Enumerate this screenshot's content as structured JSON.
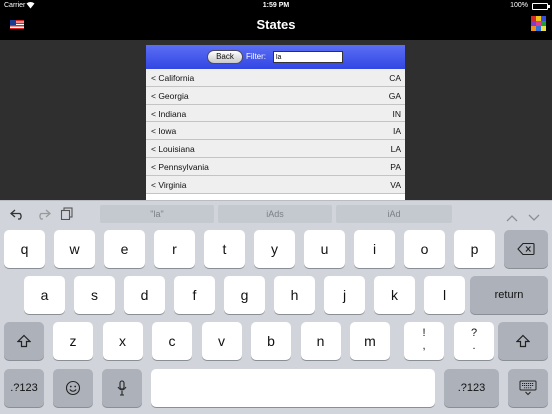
{
  "status_bar": {
    "carrier": "Carrier",
    "time": "1:59 PM",
    "battery": "100%"
  },
  "nav": {
    "title": "States",
    "grid_colors": [
      "#d62a2a",
      "#f2c318",
      "#3a4fd9",
      "#7f3cc8",
      "#e23c8e",
      "#1f9e3a",
      "#f28c1a",
      "#2f71d6",
      "#e8e34a"
    ]
  },
  "filter": {
    "back_label": "Back",
    "label": "Filter:",
    "value": "la"
  },
  "states": [
    {
      "name": "< California",
      "abbr": "CA"
    },
    {
      "name": "< Georgia",
      "abbr": "GA"
    },
    {
      "name": "< Indiana",
      "abbr": "IN"
    },
    {
      "name": "< Iowa",
      "abbr": "IA"
    },
    {
      "name": "< Louisiana",
      "abbr": "LA"
    },
    {
      "name": "< Pennsylvania",
      "abbr": "PA"
    },
    {
      "name": "< Virginia",
      "abbr": "VA"
    }
  ],
  "suggestions": [
    "\"la\"",
    "iAds",
    "iAd"
  ],
  "keyboard": {
    "row1": [
      "q",
      "w",
      "e",
      "r",
      "t",
      "y",
      "u",
      "i",
      "o",
      "p"
    ],
    "row2": [
      "a",
      "s",
      "d",
      "f",
      "g",
      "h",
      "j",
      "k",
      "l"
    ],
    "row2_return": "return",
    "row3": [
      "z",
      "x",
      "c",
      "v",
      "b",
      "n",
      "m"
    ],
    "row3_punct1": [
      "!",
      ","
    ],
    "row3_punct2": [
      "?",
      "."
    ],
    "numbers_label": ".?123"
  },
  "colors": {
    "nav_bg": "#000000",
    "filter_bar": "#3f54ee",
    "keyboard_bg": "#d1d5db"
  }
}
